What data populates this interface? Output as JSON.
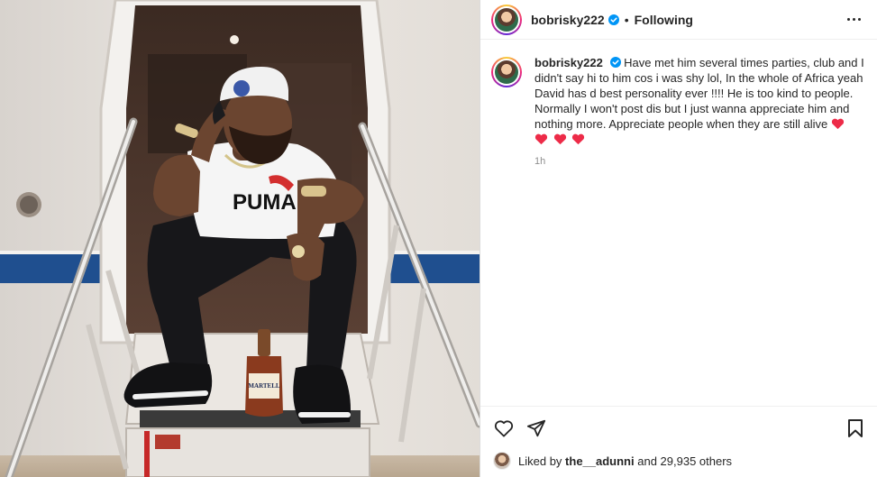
{
  "post": {
    "username": "bobrisky222",
    "follow_status": "Following",
    "separator": "•",
    "caption_text": "Have met him several times parties, club and I didn't say hi to him cos i was shy lol, In the whole of Africa yeah David has d best personality ever !!!! He is too kind to people. Normally I won't post dis but I just wanna appreciate him and nothing more. Appreciate people when they are still alive",
    "caption_emoji_count": 4,
    "time_ago": "1h",
    "likes": {
      "prefix": "Liked by",
      "user": "the__adunni",
      "suffix": "and 29,935 others"
    },
    "photo": {
      "shirt_text": "PUMA",
      "bottle_label": "MARTELL"
    }
  },
  "icons": {
    "verified": "verified-badge-icon",
    "more": "more-options-icon",
    "like": "heart-outline-icon",
    "share": "paper-plane-icon",
    "save": "bookmark-icon",
    "emoji": "red-heart-emoji"
  },
  "colors": {
    "verified_blue": "#0095f6",
    "heart_red": "#ed2b48",
    "muted_text": "#8e8e8e",
    "plane_stripe": "#1f4f8f"
  }
}
